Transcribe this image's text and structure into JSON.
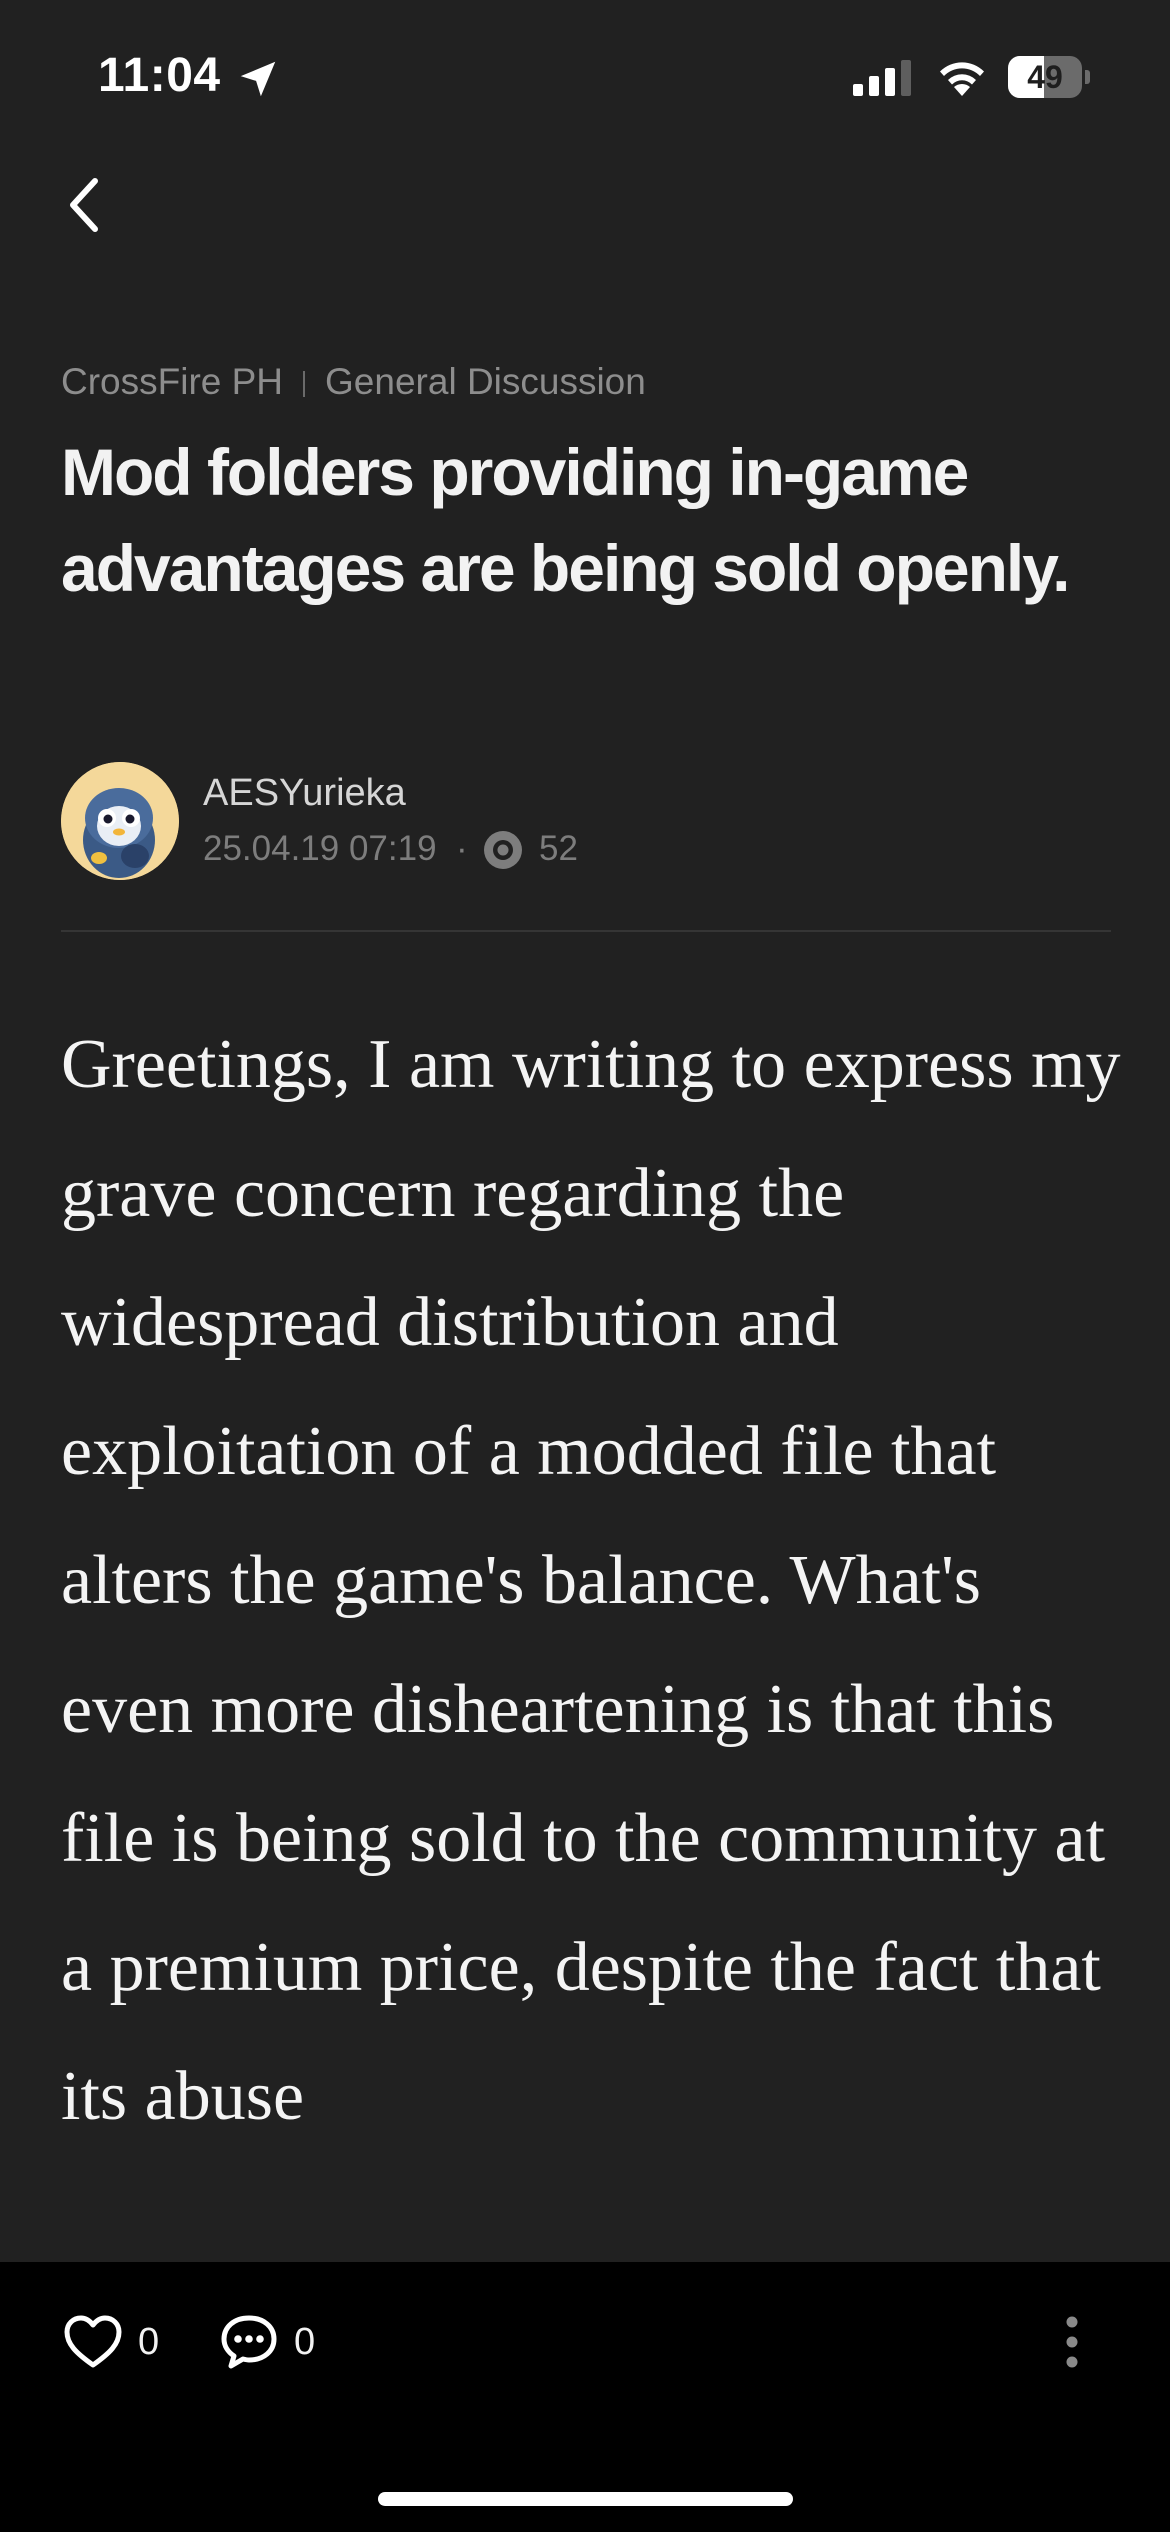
{
  "status_bar": {
    "time": "11:04",
    "battery_level": "49",
    "battery_fraction": 0.49,
    "icons": [
      "location-arrow-icon",
      "cellular-signal-icon",
      "wifi-icon",
      "battery-icon"
    ]
  },
  "header": {
    "back_icon": "chevron-left-icon"
  },
  "post": {
    "breadcrumb": {
      "community": "CrossFire PH",
      "board": "General Discussion"
    },
    "title": "Mod folders providing in-game advantages are being sold openly.",
    "author": {
      "name": "AESYurieka",
      "avatar": "penguin-avatar"
    },
    "date": "25.04.19 07:19",
    "separator": "·",
    "views": "52",
    "body": "Greetings, I am writing to express my grave concern regarding the widespread distribution and exploitation of a modded file that alters the game's balance. What's even more disheartening is that this file is being sold to the community at a premium price, despite the fact that its abuse"
  },
  "actions": {
    "likes": "0",
    "comments": "0",
    "icons": [
      "heart-icon",
      "comment-bubble-icon",
      "more-vertical-icon"
    ]
  },
  "colors": {
    "background": "#212121",
    "action_bar": "#000000",
    "text_primary": "#f2f2f2",
    "text_secondary": "#7d7d7d",
    "avatar_bg": "#f4d89a"
  }
}
